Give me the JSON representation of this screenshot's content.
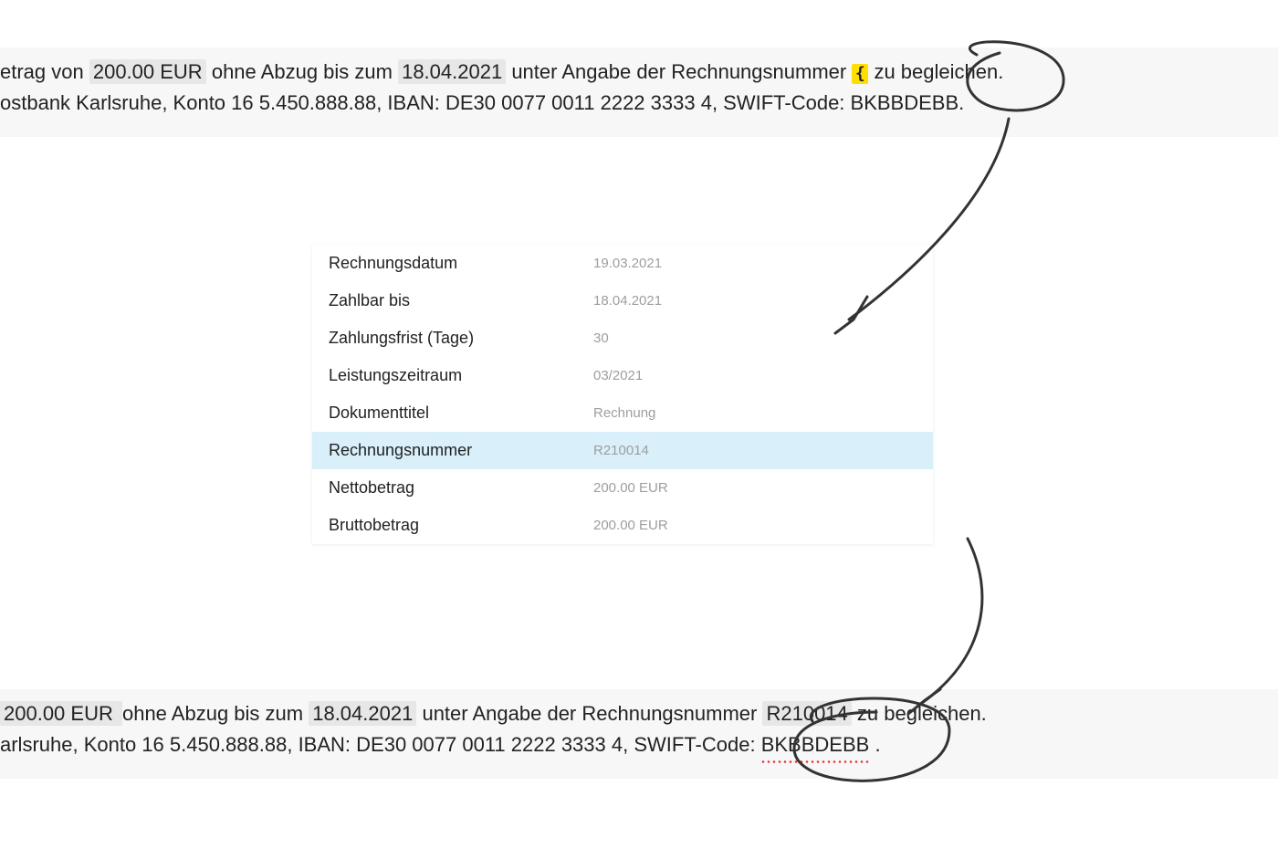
{
  "top": {
    "line1_pre": "etrag von ",
    "amount": "200.00 EUR",
    "line1_mid1": " ohne Abzug bis zum ",
    "due_date": "18.04.2021",
    "line1_mid2": " unter Angabe der Rechnungsnummer ",
    "cursor_glyph": "{",
    "line1_post": " zu begleichen.",
    "line2": "ostbank Karlsruhe, Konto 16 5.450.888.88, IBAN: DE30 0077 0011 2222 3333 4, SWIFT-Code: BKBBDEBB."
  },
  "table": [
    {
      "label": "Rechnungsdatum",
      "value": "19.03.2021",
      "hl": false
    },
    {
      "label": "Zahlbar bis",
      "value": "18.04.2021",
      "hl": false
    },
    {
      "label": "Zahlungsfrist (Tage)",
      "value": "30",
      "hl": false
    },
    {
      "label": "Leistungszeitraum",
      "value": "03/2021",
      "hl": false
    },
    {
      "label": "Dokumenttitel",
      "value": "Rechnung",
      "hl": false
    },
    {
      "label": "Rechnungsnummer",
      "value": "R210014",
      "hl": true
    },
    {
      "label": "Nettobetrag",
      "value": "200.00 EUR",
      "hl": false
    },
    {
      "label": "Bruttobetrag",
      "value": "200.00 EUR",
      "hl": false
    }
  ],
  "bottom": {
    "line1_pre_gray": " 200.00 EUR ",
    "line1_mid1": " ohne Abzug bis zum ",
    "due_date": "18.04.2021",
    "line1_mid2": " unter Angabe der Rechnungsnummer ",
    "inv_no": "R210014",
    "line1_post": " zu begleichen.",
    "line2_pre": "arlsruhe, Konto 16 5.450.888.88, IBAN: DE30 0077 0011 2222 3333 4, SWIFT-Code: ",
    "swift": "BKBBDEBB",
    "line2_post": "."
  }
}
